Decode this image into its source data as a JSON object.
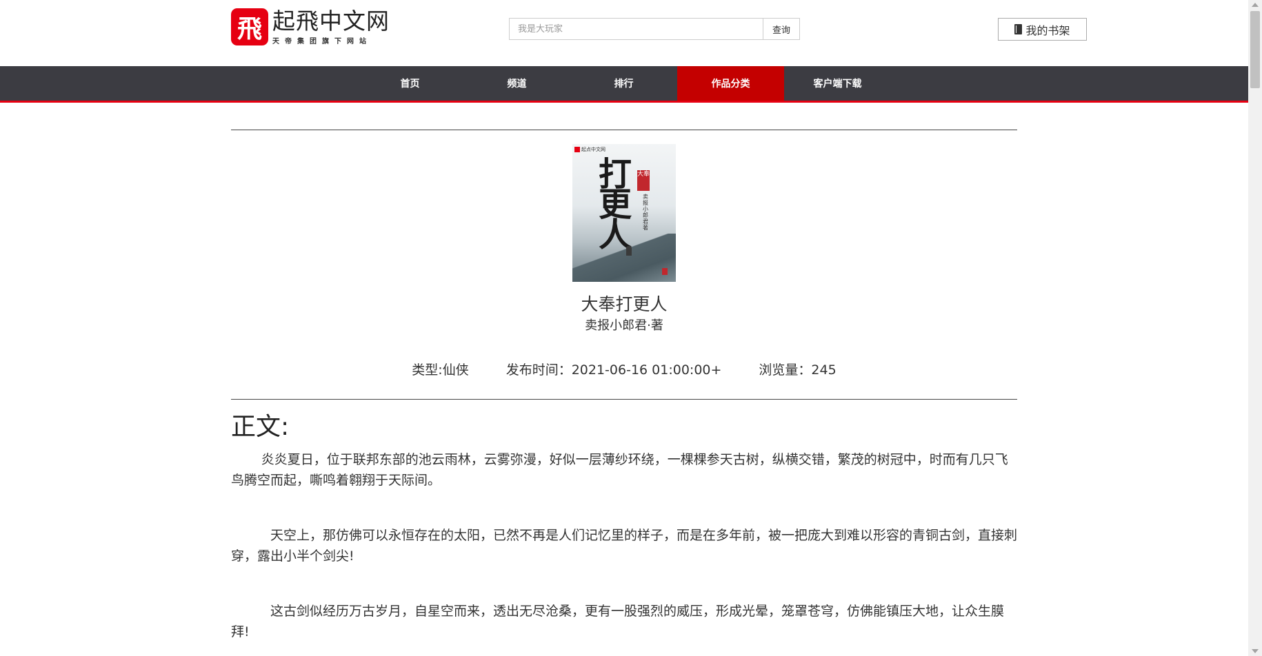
{
  "header": {
    "logo_mark": "飛",
    "logo_title": "起飛中文网",
    "logo_sub": "天帝集团旗下网站",
    "search_placeholder": "我是大玩家",
    "search_button": "查询",
    "shelf_button": "我的书架"
  },
  "nav": {
    "items": [
      {
        "label": "首页"
      },
      {
        "label": "频道"
      },
      {
        "label": "排行"
      },
      {
        "label": "作品分类",
        "active": true
      },
      {
        "label": "客户端下载"
      }
    ]
  },
  "book": {
    "title": "大奉打更人",
    "author": "卖报小郎君·著",
    "cover": {
      "brand": "起点中文网",
      "calligraphy": "打更人",
      "seal": "大奉",
      "author_vertical": "卖报小郎君著"
    },
    "meta": {
      "type": "类型:仙侠",
      "publish_time": "发布时间：2021-06-16 01:00:00+",
      "views": "浏览量：245"
    }
  },
  "body": {
    "section_title": "正文:",
    "paragraphs": [
      "炎炎夏日，位于联邦东部的池云雨林，云雾弥漫，好似一层薄纱环绕，一棵棵参天古树，纵横交错，繁茂的树冠中，时而有几只飞鸟腾空而起，嘶鸣着翱翔于天际间。",
      "天空上，那仿佛可以永恒存在的太阳，已然不再是人们记忆里的样子，而是在多年前，被一把庞大到难以形容的青铜古剑，直接刺穿，露出小半个剑尖!",
      "这古剑似经历万古岁月，自星空而来，透出无尽沧桑，更有一股强烈的威压，形成光晕，笼罩苍穹，仿佛能镇压大地，让众生膜拜!"
    ]
  },
  "colors": {
    "brand_red": "#e60012",
    "nav_bg": "#3c3c42",
    "nav_active": "#c40000"
  }
}
